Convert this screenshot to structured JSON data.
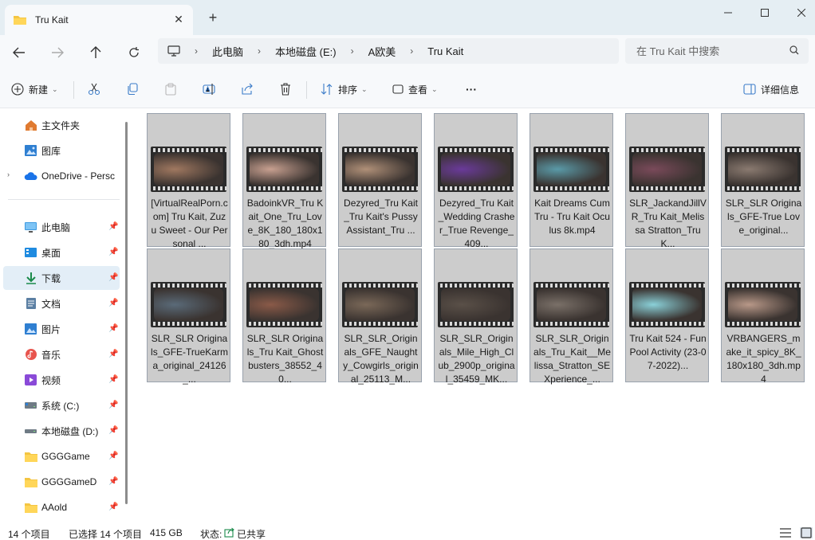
{
  "window": {
    "tab_title": "Tru Kait",
    "new_tab": "+",
    "close_tab": "✕"
  },
  "address": {
    "crumbs": [
      "此电脑",
      "本地磁盘 (E:)",
      "A欧美",
      "Tru Kait"
    ],
    "search_placeholder": "在 Tru Kait 中搜索"
  },
  "commands": {
    "new": "新建",
    "sort": "排序",
    "view": "查看",
    "more": "···",
    "details": "详细信息"
  },
  "sidebar": {
    "items": [
      {
        "label": "主文件夹",
        "icon": "home-icon"
      },
      {
        "label": "图库",
        "icon": "gallery-icon"
      },
      {
        "label": "OneDrive - Persc",
        "icon": "cloud-icon"
      },
      {
        "label": "此电脑",
        "icon": "monitor-icon"
      },
      {
        "label": "桌面",
        "icon": "desktop-icon"
      },
      {
        "label": "下载",
        "icon": "download-icon"
      },
      {
        "label": "文档",
        "icon": "document-icon"
      },
      {
        "label": "图片",
        "icon": "picture-icon"
      },
      {
        "label": "音乐",
        "icon": "music-icon"
      },
      {
        "label": "视频",
        "icon": "video-icon"
      },
      {
        "label": "系统 (C:)",
        "icon": "drive-icon"
      },
      {
        "label": "本地磁盘 (D:)",
        "icon": "drive-icon"
      },
      {
        "label": "GGGGame",
        "icon": "folder-icon"
      },
      {
        "label": "GGGGameD",
        "icon": "folder-icon"
      },
      {
        "label": "AAold",
        "icon": "folder-icon"
      }
    ]
  },
  "files": [
    {
      "name": "[VirtualRealPorn.com] Tru Kait, Zuzu Sweet - Our Personal ...",
      "color": "#a07860"
    },
    {
      "name": "BadoinkVR_Tru Kait_One_Tru_Love_8K_180_180x180_3dh.mp4",
      "color": "#c8a090"
    },
    {
      "name": "Dezyred_Tru Kait_Tru Kait's Pussy Assistant_Tru ...",
      "color": "#b09078"
    },
    {
      "name": "Dezyred_Tru Kait_Wedding Crasher_True Revenge_409...",
      "color": "#6a3a9a"
    },
    {
      "name": "Kait Dreams Cum Tru - Tru Kait Oculus 8k.mp4",
      "color": "#5a9aa8"
    },
    {
      "name": "SLR_JackandJillVR_Tru Kait_Melissa Stratton_TruK...",
      "color": "#7a4a5a"
    },
    {
      "name": "SLR_SLR Originals_GFE-True Love_original...",
      "color": "#8a7a70"
    },
    {
      "name": "SLR_SLR Originals_GFE-TrueKarma_original_24126_...",
      "color": "#5a6a78"
    },
    {
      "name": "SLR_SLR Originals_Tru Kait_Ghostbusters_38552_40...",
      "color": "#8a5a48"
    },
    {
      "name": "SLR_SLR_Originals_GFE_Naughty_Cowgirls_original_25113_M...",
      "color": "#7a6858"
    },
    {
      "name": "SLR_SLR_Originals_Mile_High_Club_2900p_original_35459_MK...",
      "color": "#5a5048"
    },
    {
      "name": "SLR_SLR_Originals_Tru_Kait__Melissa_Stratton_SEXperience_...",
      "color": "#7a7068"
    },
    {
      "name": "Tru Kait 524 - Fun Pool Activity (23-07-2022)...",
      "color": "#8ad0d8"
    },
    {
      "name": "VRBANGERS_make_it_spicy_8K_180x180_3dh.mp4",
      "color": "#b89888"
    }
  ],
  "status": {
    "count": "14 个项目",
    "selected": "已选择 14 个项目",
    "size": "415 GB",
    "state_label": "状态:",
    "state_value": "已共享"
  }
}
